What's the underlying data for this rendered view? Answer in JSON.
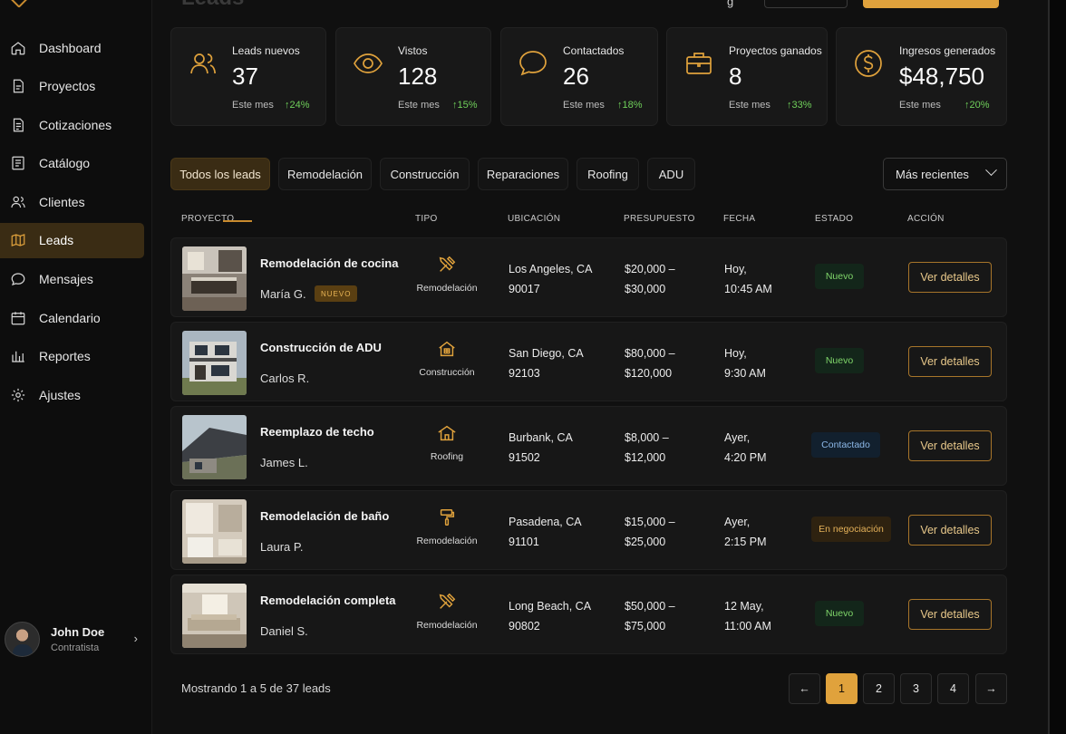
{
  "header": {
    "title": "Leads",
    "top_right_text": "g"
  },
  "sidebar": {
    "items": [
      {
        "label": "Dashboard",
        "icon": "home-icon"
      },
      {
        "label": "Proyectos",
        "icon": "document-icon"
      },
      {
        "label": "Cotizaciones",
        "icon": "quote-icon"
      },
      {
        "label": "Catálogo",
        "icon": "catalog-icon"
      },
      {
        "label": "Clientes",
        "icon": "users-icon"
      },
      {
        "label": "Leads",
        "icon": "map-icon",
        "active": true
      },
      {
        "label": "Mensajes",
        "icon": "chat-icon"
      },
      {
        "label": "Calendario",
        "icon": "calendar-icon"
      },
      {
        "label": "Reportes",
        "icon": "chart-icon"
      },
      {
        "label": "Ajustes",
        "icon": "gear-icon"
      }
    ],
    "user": {
      "name": "John Doe",
      "role": "Contratista"
    }
  },
  "stats": [
    {
      "label": "Leads nuevos",
      "value": "37",
      "period": "Este mes",
      "trend": "↑24%",
      "icon": "users-icon"
    },
    {
      "label": "Vistos",
      "value": "128",
      "period": "Este mes",
      "trend": "↑15%",
      "icon": "eye-icon"
    },
    {
      "label": "Contactados",
      "value": "26",
      "period": "Este mes",
      "trend": "↑18%",
      "icon": "chat-bubble-icon"
    },
    {
      "label": "Proyectos ganados",
      "value": "8",
      "period": "Este mes",
      "trend": "↑33%",
      "icon": "briefcase-icon"
    },
    {
      "label": "Ingresos generados",
      "value": "$48,750",
      "period": "Este mes",
      "trend": "↑20%",
      "icon": "dollar-icon"
    }
  ],
  "filters": {
    "tabs": [
      "Todos los leads",
      "Remodelación",
      "Construcción",
      "Reparaciones",
      "Roofing",
      "ADU"
    ],
    "active_tab": "Todos los leads",
    "sort": "Más recientes"
  },
  "table": {
    "columns": [
      "PROYECTO",
      "TIPO",
      "UBICACIÓN",
      "PRESUPUESTO",
      "FECHA",
      "ESTADO",
      "ACCIÓN"
    ],
    "rows": [
      {
        "title": "Remodelación de cocina",
        "client": "María G.",
        "badge": "NUEVO",
        "type": "Remodelación",
        "type_icon": "tools-icon",
        "loc1": "Los Angeles, CA",
        "loc2": "90017",
        "bud1": "$20,000 –",
        "bud2": "$30,000",
        "date1": "Hoy,",
        "date2": "10:45 AM",
        "status": "Nuevo",
        "status_kind": "nuevo",
        "action": "Ver detalles",
        "image": "kitchen-photo"
      },
      {
        "title": "Construcción de ADU",
        "client": "Carlos R.",
        "badge": "",
        "type": "Construcción",
        "type_icon": "house-icon",
        "loc1": "San Diego, CA",
        "loc2": "92103",
        "bud1": "$80,000 –",
        "bud2": "$120,000",
        "date1": "Hoy,",
        "date2": "9:30 AM",
        "status": "Nuevo",
        "status_kind": "nuevo",
        "action": "Ver detalles",
        "image": "adu-photo"
      },
      {
        "title": "Reemplazo de techo",
        "client": "James L.",
        "badge": "",
        "type": "Roofing",
        "type_icon": "roof-icon",
        "loc1": "Burbank, CA",
        "loc2": "91502",
        "bud1": "$8,000 –",
        "bud2": "$12,000",
        "date1": "Ayer,",
        "date2": "4:20 PM",
        "status": "Contactado",
        "status_kind": "contactado",
        "action": "Ver detalles",
        "image": "roof-photo"
      },
      {
        "title": "Remodelación de baño",
        "client": "Laura P.",
        "badge": "",
        "type": "Remodelación",
        "type_icon": "paint-roller-icon",
        "loc1": "Pasadena, CA",
        "loc2": "91101",
        "bud1": "$15,000 –",
        "bud2": "$25,000",
        "date1": "Ayer,",
        "date2": "2:15 PM",
        "status": "En negociación",
        "status_kind": "negociacion",
        "action": "Ver detalles",
        "image": "bathroom-photo"
      },
      {
        "title": "Remodelación completa",
        "client": "Daniel S.",
        "badge": "",
        "type": "Remodelación",
        "type_icon": "tools-icon",
        "loc1": "Long Beach, CA",
        "loc2": "90802",
        "bud1": "$50,000 –",
        "bud2": "$75,000",
        "date1": "12 May,",
        "date2": "11:00 AM",
        "status": "Nuevo",
        "status_kind": "nuevo",
        "action": "Ver detalles",
        "image": "living-room-photo"
      }
    ]
  },
  "footer": {
    "showing": "Mostrando 1 a 5 de 37 leads",
    "pages": [
      "1",
      "2",
      "3",
      "4"
    ],
    "prev": "←",
    "next": "→",
    "current_page": "1"
  },
  "colors": {
    "accent": "#e0a23c",
    "background": "#101010",
    "card": "#181818",
    "trend_up": "#6fcf5a"
  }
}
